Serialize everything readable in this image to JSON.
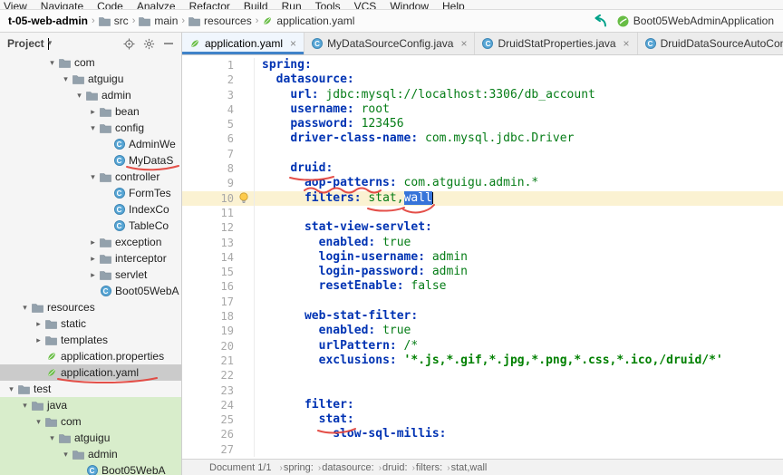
{
  "menu": {
    "items": [
      "View",
      "Navigate",
      "Code",
      "Analyze",
      "Refactor",
      "Build",
      "Run",
      "Tools",
      "VCS",
      "Window",
      "Help"
    ]
  },
  "navigation": {
    "breadcrumbs": [
      {
        "label": "t-05-web-admin",
        "icon": "none"
      },
      {
        "label": "src",
        "icon": "folder"
      },
      {
        "label": "main",
        "icon": "folder"
      },
      {
        "label": "resources",
        "icon": "folder"
      },
      {
        "label": "application.yaml",
        "icon": "spring"
      }
    ],
    "run_config": "Boot05WebAdminApplication"
  },
  "project": {
    "title": "Project",
    "tree": [
      {
        "label": "com",
        "icon": "folder",
        "level": 3,
        "chevron": "down"
      },
      {
        "label": "atguigu",
        "icon": "folder",
        "level": 4,
        "chevron": "down"
      },
      {
        "label": "admin",
        "icon": "folder",
        "level": 5,
        "chevron": "down"
      },
      {
        "label": "bean",
        "icon": "folder",
        "level": 6,
        "chevron": "right"
      },
      {
        "label": "config",
        "icon": "folder",
        "level": 6,
        "chevron": "down"
      },
      {
        "label": "AdminWe",
        "icon": "class",
        "level": 7,
        "chevron": "none"
      },
      {
        "label": "MyDataS",
        "icon": "class",
        "level": 7,
        "chevron": "none"
      },
      {
        "label": "controller",
        "icon": "folder",
        "level": 6,
        "chevron": "down"
      },
      {
        "label": "FormTes",
        "icon": "class",
        "level": 7,
        "chevron": "none"
      },
      {
        "label": "IndexCo",
        "icon": "class",
        "level": 7,
        "chevron": "none"
      },
      {
        "label": "TableCo",
        "icon": "class",
        "level": 7,
        "chevron": "none"
      },
      {
        "label": "exception",
        "icon": "folder",
        "level": 6,
        "chevron": "right"
      },
      {
        "label": "interceptor",
        "icon": "folder",
        "level": 6,
        "chevron": "right"
      },
      {
        "label": "servlet",
        "icon": "folder",
        "level": 6,
        "chevron": "right"
      },
      {
        "label": "Boot05WebA",
        "icon": "class",
        "level": 6,
        "chevron": "none"
      },
      {
        "label": "resources",
        "icon": "folder",
        "level": 1,
        "chevron": "down"
      },
      {
        "label": "static",
        "icon": "folder",
        "level": 2,
        "chevron": "right"
      },
      {
        "label": "templates",
        "icon": "folder",
        "level": 2,
        "chevron": "right"
      },
      {
        "label": "application.properties",
        "icon": "spring",
        "level": 2,
        "chevron": "none"
      },
      {
        "label": "application.yaml",
        "icon": "spring",
        "level": 2,
        "chevron": "none",
        "selected": true
      },
      {
        "label": "test",
        "icon": "folder",
        "level": 0,
        "chevron": "down"
      },
      {
        "label": "java",
        "icon": "folder",
        "level": 1,
        "chevron": "down",
        "green": true
      },
      {
        "label": "com",
        "icon": "folder",
        "level": 2,
        "chevron": "down",
        "green": true
      },
      {
        "label": "atguigu",
        "icon": "folder",
        "level": 3,
        "chevron": "down",
        "green": true
      },
      {
        "label": "admin",
        "icon": "folder",
        "level": 4,
        "chevron": "down",
        "green": true
      },
      {
        "label": "Boot05WebA",
        "icon": "class",
        "level": 5,
        "chevron": "none",
        "green": true
      }
    ]
  },
  "tabs": [
    {
      "label": "application.yaml",
      "icon": "spring",
      "selected": true
    },
    {
      "label": "MyDataSourceConfig.java",
      "icon": "class",
      "selected": false
    },
    {
      "label": "DruidStatProperties.java",
      "icon": "class",
      "selected": false
    },
    {
      "label": "DruidDataSourceAutoConfigure.java",
      "icon": "class",
      "selected": false
    }
  ],
  "editor": {
    "current_line": 10,
    "bulb_line": 10,
    "caret_line": 10,
    "selection_text": "wall",
    "red_marks": [
      "druid:",
      "aop-patterns",
      "stat,",
      "wall",
      "stat:",
      "application.yaml (tree)",
      "MyDataS (tree)"
    ],
    "lines": [
      {
        "n": 1,
        "t": [
          [
            "k",
            "spring:"
          ]
        ]
      },
      {
        "n": 2,
        "t": [
          [
            "p",
            "  "
          ],
          [
            "k",
            "datasource:"
          ]
        ]
      },
      {
        "n": 3,
        "t": [
          [
            "p",
            "    "
          ],
          [
            "k",
            "url:"
          ],
          [
            "p",
            " "
          ],
          [
            "v",
            "jdbc:mysql://localhost:3306/db_account"
          ]
        ]
      },
      {
        "n": 4,
        "t": [
          [
            "p",
            "    "
          ],
          [
            "k",
            "username:"
          ],
          [
            "p",
            " "
          ],
          [
            "v",
            "root"
          ]
        ]
      },
      {
        "n": 5,
        "t": [
          [
            "p",
            "    "
          ],
          [
            "k",
            "password:"
          ],
          [
            "p",
            " "
          ],
          [
            "v",
            "123456"
          ]
        ]
      },
      {
        "n": 6,
        "t": [
          [
            "p",
            "    "
          ],
          [
            "k",
            "driver-class-name:"
          ],
          [
            "p",
            " "
          ],
          [
            "v",
            "com.mysql.jdbc.Driver"
          ]
        ]
      },
      {
        "n": 7,
        "t": []
      },
      {
        "n": 8,
        "t": [
          [
            "p",
            "    "
          ],
          [
            "k",
            "druid:"
          ]
        ]
      },
      {
        "n": 9,
        "t": [
          [
            "p",
            "      "
          ],
          [
            "k",
            "aop-patterns:"
          ],
          [
            "p",
            " "
          ],
          [
            "v",
            "com.atguigu.admin.*"
          ]
        ]
      },
      {
        "n": 10,
        "t": [
          [
            "p",
            "      "
          ],
          [
            "k",
            "filters:"
          ],
          [
            "p",
            " "
          ],
          [
            "v",
            "stat,"
          ],
          [
            "sel",
            "wall"
          ]
        ]
      },
      {
        "n": 11,
        "t": []
      },
      {
        "n": 12,
        "t": [
          [
            "p",
            "      "
          ],
          [
            "k",
            "stat-view-servlet:"
          ]
        ]
      },
      {
        "n": 13,
        "t": [
          [
            "p",
            "        "
          ],
          [
            "k",
            "enabled:"
          ],
          [
            "p",
            " "
          ],
          [
            "v",
            "true"
          ]
        ]
      },
      {
        "n": 14,
        "t": [
          [
            "p",
            "        "
          ],
          [
            "k",
            "login-username:"
          ],
          [
            "p",
            " "
          ],
          [
            "v",
            "admin"
          ]
        ]
      },
      {
        "n": 15,
        "t": [
          [
            "p",
            "        "
          ],
          [
            "k",
            "login-password:"
          ],
          [
            "p",
            " "
          ],
          [
            "v",
            "admin"
          ]
        ]
      },
      {
        "n": 16,
        "t": [
          [
            "p",
            "        "
          ],
          [
            "k",
            "resetEnable:"
          ],
          [
            "p",
            " "
          ],
          [
            "v",
            "false"
          ]
        ]
      },
      {
        "n": 17,
        "t": []
      },
      {
        "n": 18,
        "t": [
          [
            "p",
            "      "
          ],
          [
            "k",
            "web-stat-filter:"
          ]
        ]
      },
      {
        "n": 19,
        "t": [
          [
            "p",
            "        "
          ],
          [
            "k",
            "enabled:"
          ],
          [
            "p",
            " "
          ],
          [
            "v",
            "true"
          ]
        ]
      },
      {
        "n": 20,
        "t": [
          [
            "p",
            "        "
          ],
          [
            "k",
            "urlPattern:"
          ],
          [
            "p",
            " "
          ],
          [
            "v",
            "/*"
          ]
        ]
      },
      {
        "n": 21,
        "t": [
          [
            "p",
            "        "
          ],
          [
            "k",
            "exclusions:"
          ],
          [
            "p",
            " "
          ],
          [
            "s",
            "'*.js,*.gif,*.jpg,*.png,*.css,*.ico,/druid/*'"
          ]
        ]
      },
      {
        "n": 22,
        "t": []
      },
      {
        "n": 23,
        "t": []
      },
      {
        "n": 24,
        "t": [
          [
            "p",
            "      "
          ],
          [
            "k",
            "filter:"
          ]
        ]
      },
      {
        "n": 25,
        "t": [
          [
            "p",
            "        "
          ],
          [
            "k",
            "stat:"
          ]
        ]
      },
      {
        "n": 26,
        "t": [
          [
            "p",
            "          "
          ],
          [
            "k",
            "slow-sql-millis:"
          ]
        ]
      },
      {
        "n": 27,
        "t": []
      }
    ]
  },
  "status": {
    "document": "Document 1/1",
    "path": [
      "spring:",
      "datasource:",
      "druid:",
      "filters:",
      "stat,wall"
    ]
  },
  "colors": {
    "key": "#0033B3",
    "val": "#067D17",
    "str": "#008000",
    "sel": "#3674D9",
    "ann": "#E2413A",
    "spring_green": "#68BD45",
    "class_blue": "#59A7D6",
    "tab_accent": "#4083C9",
    "current_line_bg": "#FBF2D2",
    "test_row_green": "#D8EDCB"
  }
}
